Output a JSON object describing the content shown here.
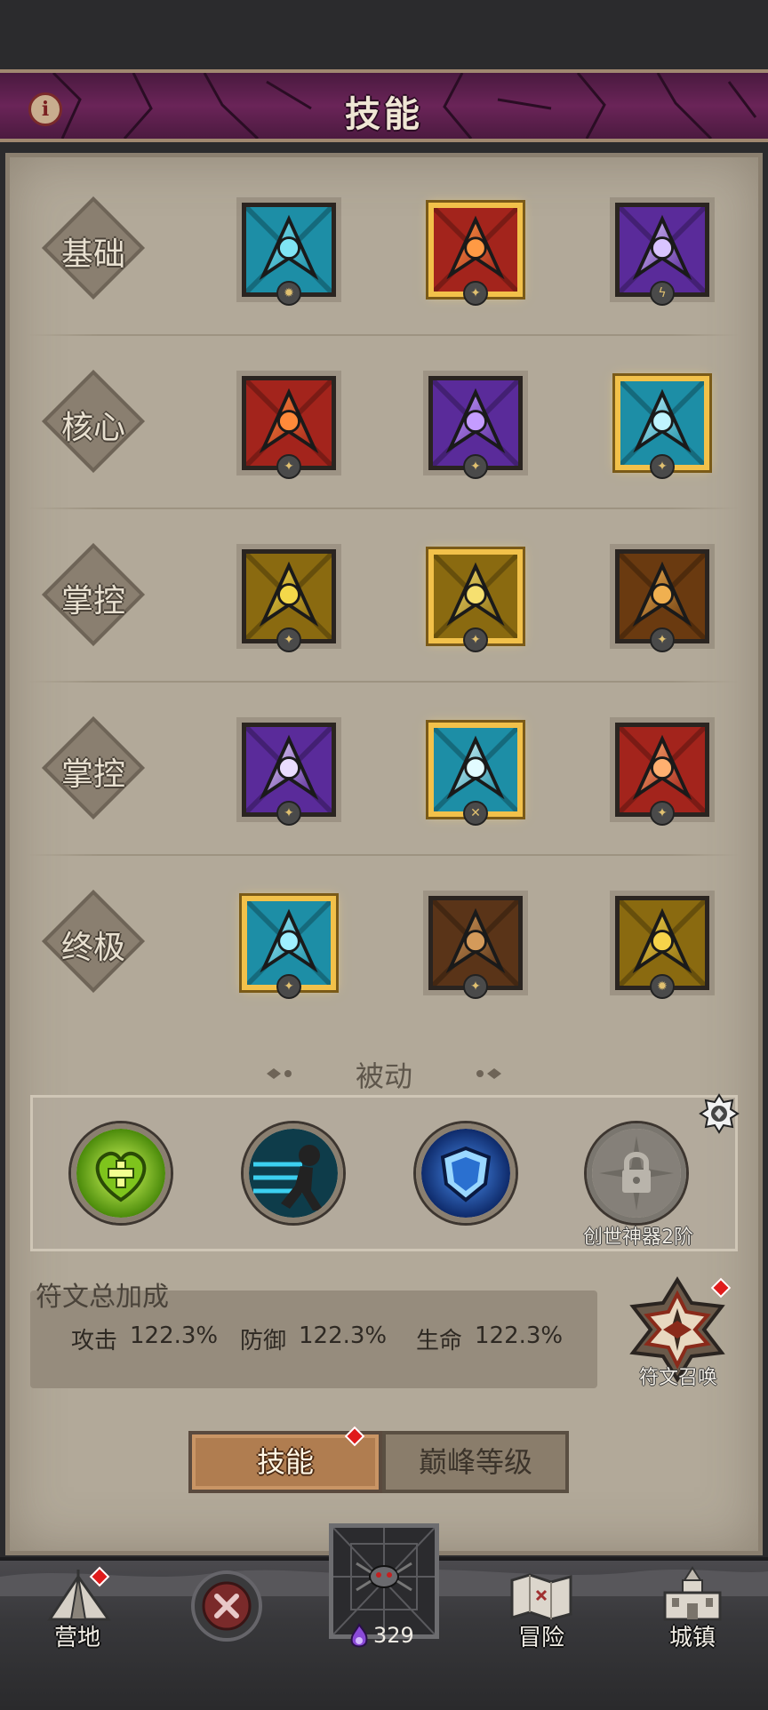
{
  "header": {
    "title": "技能",
    "info_icon": "i"
  },
  "rows": [
    {
      "label": "基础",
      "skills": [
        {
          "name": "ice-arrow",
          "gold": false,
          "colors": [
            "#1d8ea6",
            "#7fe4f4"
          ],
          "badge": "✹"
        },
        {
          "name": "fire-strike",
          "gold": true,
          "colors": [
            "#a3241c",
            "#ff9a44"
          ],
          "badge": "✦"
        },
        {
          "name": "lightning-bolt",
          "gold": false,
          "colors": [
            "#5a2b9a",
            "#d9c4ff"
          ],
          "badge": "ϟ"
        }
      ]
    },
    {
      "label": "核心",
      "skills": [
        {
          "name": "fireball",
          "gold": false,
          "colors": [
            "#a3241c",
            "#ff8a3a"
          ],
          "badge": "✦"
        },
        {
          "name": "thunder-fist",
          "gold": false,
          "colors": [
            "#5a2b9a",
            "#c49cff"
          ],
          "badge": "✦"
        },
        {
          "name": "ice-shards",
          "gold": true,
          "colors": [
            "#1d8ea6",
            "#bff4ff"
          ],
          "badge": "✦"
        }
      ]
    },
    {
      "label": "掌控",
      "skills": [
        {
          "name": "golden-crown",
          "gold": false,
          "colors": [
            "#8a6a10",
            "#f3d84a"
          ],
          "badge": "✦"
        },
        {
          "name": "golden-dash",
          "gold": true,
          "colors": [
            "#8a6a10",
            "#f6e070"
          ],
          "badge": "✦"
        },
        {
          "name": "meteor-swirl",
          "gold": false,
          "colors": [
            "#6a3a10",
            "#f0b050"
          ],
          "badge": "✦"
        }
      ]
    },
    {
      "label": "掌控",
      "skills": [
        {
          "name": "lightning-orb",
          "gold": false,
          "colors": [
            "#5a2b9a",
            "#eadcff"
          ],
          "badge": "✦"
        },
        {
          "name": "frost-nova",
          "gold": true,
          "colors": [
            "#1d8ea6",
            "#e2fbff"
          ],
          "badge": "✕"
        },
        {
          "name": "fire-beast",
          "gold": false,
          "colors": [
            "#a3241c",
            "#ffb070"
          ],
          "badge": "✦"
        }
      ]
    },
    {
      "label": "终极",
      "skills": [
        {
          "name": "blizzard-vortex",
          "gold": true,
          "colors": [
            "#1d8ea6",
            "#9ff0ff"
          ],
          "badge": "✦"
        },
        {
          "name": "summon-clones",
          "gold": false,
          "colors": [
            "#5a3418",
            "#d49a5a"
          ],
          "badge": "✦"
        },
        {
          "name": "golden-avatar",
          "gold": false,
          "colors": [
            "#8a6a10",
            "#f6d34a"
          ],
          "badge": "✹"
        }
      ]
    }
  ],
  "passive": {
    "heading": "被动",
    "items": [
      {
        "name": "heart-heal",
        "colors": [
          "#5c9a10",
          "#c8f040"
        ]
      },
      {
        "name": "speed-run",
        "colors": [
          "#10607a",
          "#3cc8e8"
        ]
      },
      {
        "name": "shield-guard",
        "colors": [
          "#123a8a",
          "#58a8f0"
        ]
      },
      {
        "name": "locked-slot",
        "colors": [
          "#6a6660",
          "#9a958c"
        ]
      }
    ],
    "locked_label": "创世神器2阶"
  },
  "runes": {
    "title": "符文总加成",
    "stats": [
      {
        "label": "攻击",
        "value": "122.3%"
      },
      {
        "label": "防御",
        "value": "122.3%"
      },
      {
        "label": "生命",
        "value": "122.3%"
      }
    ],
    "summon_label": "符文召唤"
  },
  "tabs": {
    "active": "技能",
    "inactive": "巅峰等级"
  },
  "nav": {
    "camp": "营地",
    "adventure": "冒险",
    "town": "城镇",
    "currency_value": "329"
  },
  "colors": {
    "header_purple": "#5a1e4c",
    "panel_bg": "#b2a999",
    "gold_border": "#f2c14a",
    "notification_red": "#e01b1b"
  }
}
